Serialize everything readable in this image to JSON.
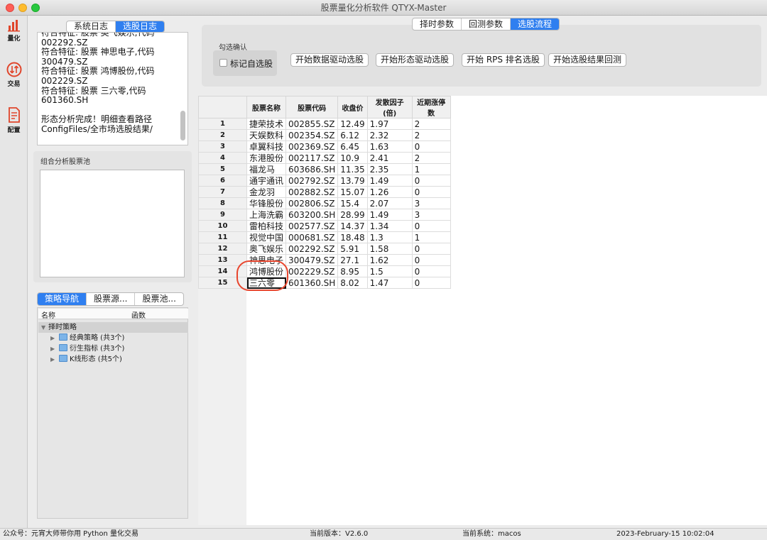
{
  "window": {
    "title": "股票量化分析软件 QTYX-Master"
  },
  "toolbar": [
    {
      "label": "量化",
      "icon": "bar-chart-icon"
    },
    {
      "label": "交易",
      "icon": "exchange-icon"
    },
    {
      "label": "配置",
      "icon": "document-icon"
    }
  ],
  "log_tabs": {
    "system": "系统日志",
    "selection": "选股日志",
    "active": "选股日志"
  },
  "log_text": "符合特征: 股票 奥飞娱乐,代码\n002292.SZ\n符合特征: 股票 神思电子,代码\n300479.SZ\n符合特征: 股票 鸿博股份,代码\n002229.SZ\n符合特征: 股票 三六零,代码\n601360.SH\n\n形态分析完成！明细查看路径\nConfigFiles/全市场选股结果/",
  "pool_section": {
    "label": "组合分析股票池"
  },
  "nav_tabs": {
    "strategy": "策略导航",
    "source": "股票源...",
    "pool": "股票池..."
  },
  "tree": {
    "col_name": "名称",
    "col_func": "函数",
    "root": "择时策略",
    "children": [
      "经典策略 (共3个)",
      "衍生指标 (共3个)",
      "K线形态 (共5个)"
    ]
  },
  "top_tabs": {
    "timing": "择时参数",
    "backtest": "回测参数",
    "selection": "选股流程",
    "active": "选股流程"
  },
  "controls": {
    "confirm_label": "勾选确认",
    "mark_checkbox": "标记自选股",
    "mark_checked": false,
    "btn_data": "开始数据驱动选股",
    "btn_pattern": "开始形态驱动选股",
    "btn_rps": "开始 RPS 排名选股",
    "btn_backtest": "开始选股结果回测"
  },
  "table": {
    "headers": [
      "股票名称",
      "股票代码",
      "收盘价",
      "发散因子(倍)",
      "近期涨停数"
    ],
    "rows": [
      [
        "1",
        "捷荣技术",
        "002855.SZ",
        "12.49",
        "1.97",
        "2"
      ],
      [
        "2",
        "天娱数科",
        "002354.SZ",
        "6.12",
        "2.32",
        "2"
      ],
      [
        "3",
        "卓翼科技",
        "002369.SZ",
        "6.45",
        "1.63",
        "0"
      ],
      [
        "4",
        "东港股份",
        "002117.SZ",
        "10.9",
        "2.41",
        "2"
      ],
      [
        "5",
        "福龙马",
        "603686.SH",
        "11.35",
        "2.35",
        "1"
      ],
      [
        "6",
        "通宇通讯",
        "002792.SZ",
        "13.79",
        "1.49",
        "0"
      ],
      [
        "7",
        "金龙羽",
        "002882.SZ",
        "15.07",
        "1.26",
        "0"
      ],
      [
        "8",
        "华锋股份",
        "002806.SZ",
        "15.4",
        "2.07",
        "3"
      ],
      [
        "9",
        "上海洗霸",
        "603200.SH",
        "28.99",
        "1.49",
        "3"
      ],
      [
        "10",
        "雷柏科技",
        "002577.SZ",
        "14.37",
        "1.34",
        "0"
      ],
      [
        "11",
        "视觉中国",
        "000681.SZ",
        "18.48",
        "1.3",
        "1"
      ],
      [
        "12",
        "奥飞娱乐",
        "002292.SZ",
        "5.91",
        "1.58",
        "0"
      ],
      [
        "13",
        "神思电子",
        "300479.SZ",
        "27.1",
        "1.62",
        "0"
      ],
      [
        "14",
        "鸿博股份",
        "002229.SZ",
        "8.95",
        "1.5",
        "0"
      ],
      [
        "15",
        "三六零",
        "601360.SH",
        "8.02",
        "1.47",
        "0"
      ]
    ],
    "selected_row": 15
  },
  "status": {
    "account": "公众号：元宵大师带你用 Python 量化交易",
    "version": "当前版本：V2.6.0",
    "system": "当前系统：macos",
    "datetime": "2023-February-15 10:02:04"
  },
  "colors": {
    "accent": "#2f7ff0",
    "annotation": "#e8462e"
  }
}
